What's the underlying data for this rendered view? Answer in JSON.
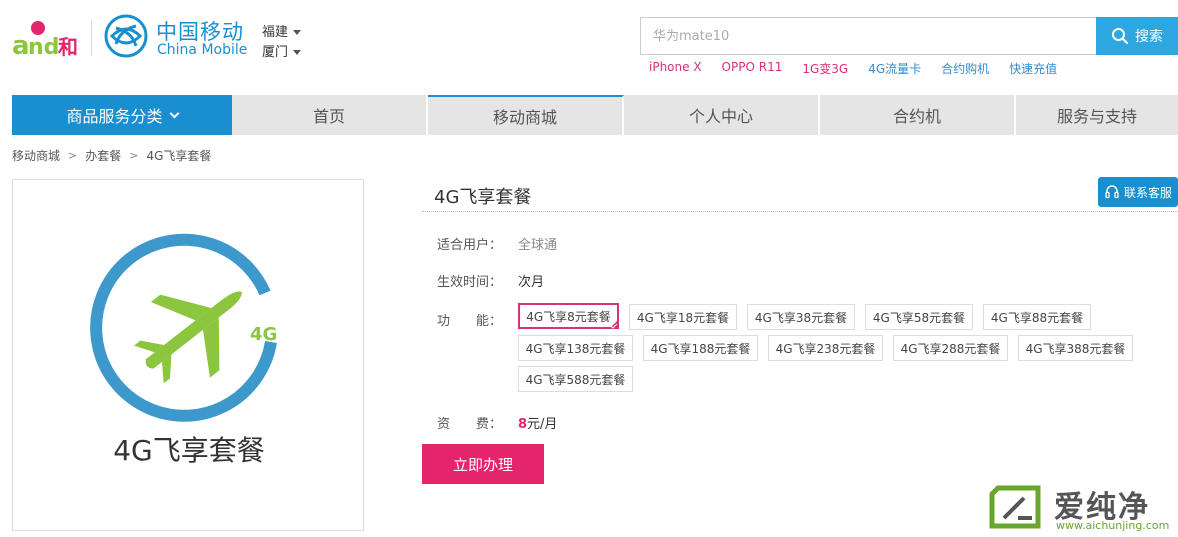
{
  "header": {
    "and_logo_text": "and和",
    "brand_cn": "中国移动",
    "brand_en": "China Mobile",
    "province": "福建",
    "city": "厦门",
    "search": {
      "placeholder": "华为mate10",
      "button_label": "搜索"
    },
    "hot_links": [
      {
        "label": "iPhone X",
        "color": "#d6317a"
      },
      {
        "label": "OPPO R11",
        "color": "#d6317a"
      },
      {
        "label": "1G变3G",
        "color": "#d6317a"
      },
      {
        "label": "4G流量卡",
        "color": "#2f8fd0"
      },
      {
        "label": "合约购机",
        "color": "#2f8fd0"
      },
      {
        "label": "快速充值",
        "color": "#2f8fd0"
      }
    ]
  },
  "nav": {
    "category_label": "商品服务分类",
    "items": [
      "首页",
      "移动商城",
      "个人中心",
      "合约机",
      "服务与支持"
    ],
    "active_index": 1
  },
  "breadcrumb": [
    "移动商城",
    "办套餐",
    "4G飞享套餐"
  ],
  "product": {
    "image_caption": "4G飞享套餐",
    "image_badge": "4G",
    "title": "4G飞享套餐",
    "service_button": "联系客服",
    "rows": {
      "users": {
        "label": "适合用户：",
        "value": "全球通"
      },
      "effective": {
        "label": "生效时间：",
        "value": "次月"
      },
      "function": {
        "label": "功　　能："
      },
      "fee": {
        "label": "资　　费：",
        "amount": "8",
        "unit": "元/月"
      }
    },
    "options": [
      "4G飞享8元套餐",
      "4G飞享18元套餐",
      "4G飞享38元套餐",
      "4G飞享58元套餐",
      "4G飞享88元套餐",
      "4G飞享138元套餐",
      "4G飞享188元套餐",
      "4G飞享238元套餐",
      "4G飞享288元套餐",
      "4G飞享388元套餐",
      "4G飞享588元套餐"
    ],
    "selected_option_index": 0,
    "apply_button": "立即办理"
  },
  "watermark": {
    "cn": "爱纯净",
    "url": "www.aichunjing.com"
  },
  "colors": {
    "brand_blue": "#1a8fd0",
    "search_blue": "#2ea7e0",
    "accent_pink": "#e4256b",
    "plane_green": "#8cc63f"
  }
}
